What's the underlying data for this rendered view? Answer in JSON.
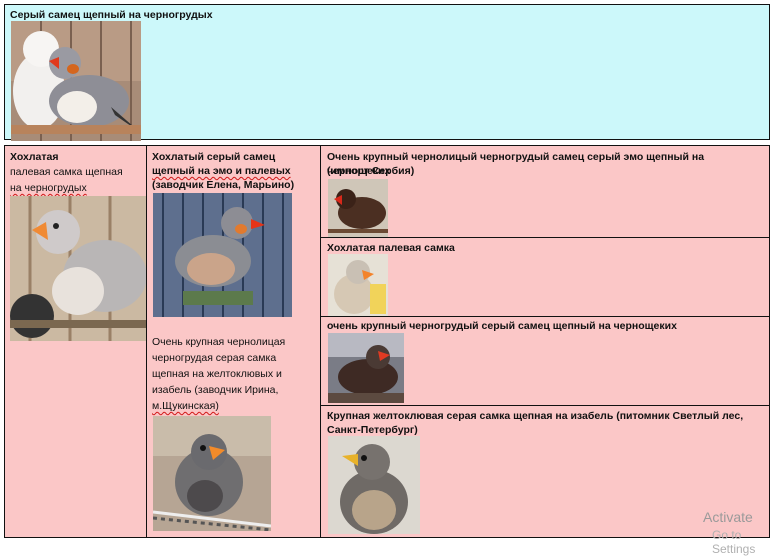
{
  "top": {
    "caption": "Серый самец  щепный на черногрудых",
    "photo_icon": "zebra-finch-pair-photo"
  },
  "col1": {
    "caption_line1": "Хохлатая",
    "caption_line2": "палевая самка  щепная",
    "caption_line3": "на черногрудых",
    "photo_icon": "pale-crested-female-photo"
  },
  "col2": {
    "caption1_line1": "Хохлатый серый самец",
    "caption1_line2": "щепный на эмо и палевых",
    "caption1_line3": "(заводчик Елена, Марьино)",
    "photo1_icon": "grey-crested-male-photo",
    "caption2_line1": "Очень крупная чернолицая",
    "caption2_line2": "черногрудая серая самка",
    "caption2_line3": "щепная на желтоклювых и",
    "caption2_line4": "изабель (заводчик Ирина,",
    "caption2_line5": "м.Щукинская)",
    "photo2_icon": "grey-female-photo"
  },
  "col3": {
    "row1_caption_line1": "Очень крупный чернолицый черногрудый самец серый эмо щепный на чернощеких",
    "row1_caption_line2": "(импорт Сербия)",
    "row1_photo_icon": "dark-male-photo",
    "row2_caption": "Хохлатая палевая самка",
    "row2_photo_icon": "pale-crested-photo",
    "row3_caption": "очень крупный черногрудый серый самец щепный на чернощеких",
    "row3_photo_icon": "black-breasted-male-photo",
    "row4_caption_line1": "Крупная желтоклювая серая самка  щепная на изабель (питомник Светлый лес,",
    "row4_caption_line2": "Санкт-Петербург)",
    "row4_photo_icon": "yellow-beak-female-photo"
  },
  "watermark": {
    "line1": "Activate",
    "line2": "Go to Settings"
  }
}
